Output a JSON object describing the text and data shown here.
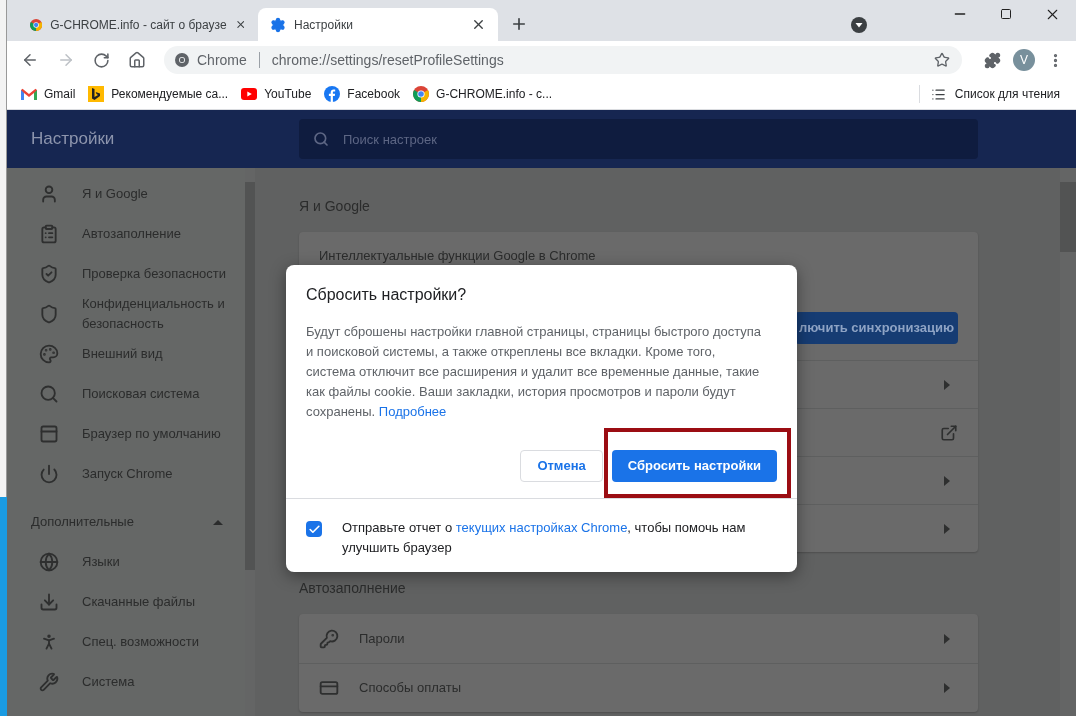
{
  "tabs": [
    {
      "title": "G-CHROME.info - сайт о браузе",
      "kind": "chrome",
      "selected": false
    },
    {
      "title": "Настройки",
      "kind": "gear",
      "selected": true
    }
  ],
  "nav": {
    "back_disabled": false,
    "forward_disabled": true
  },
  "address": {
    "site": "Chrome",
    "url": "chrome://settings/resetProfileSettings"
  },
  "profile": {
    "initial": "V"
  },
  "bookmarks": [
    {
      "label": "Gmail",
      "kind": "gmail"
    },
    {
      "label": "Рекомендуемые са...",
      "kind": "bing"
    },
    {
      "label": "YouTube",
      "kind": "youtube"
    },
    {
      "label": "Facebook",
      "kind": "facebook"
    },
    {
      "label": "G-CHROME.info - с...",
      "kind": "chrome"
    }
  ],
  "reading_list": "Список для чтения",
  "settings": {
    "title": "Настройки",
    "search_placeholder": "Поиск настроек"
  },
  "sidebar": {
    "items": [
      {
        "label": "Я и Google",
        "kind": "person"
      },
      {
        "label": "Автозаполнение",
        "kind": "clipboard"
      },
      {
        "label": "Проверка безопасности",
        "kind": "shield-check"
      },
      {
        "label": "Конфиденциальность и безопасность",
        "kind": "shield"
      },
      {
        "label": "Внешний вид",
        "kind": "palette"
      },
      {
        "label": "Поисковая система",
        "kind": "search"
      },
      {
        "label": "Браузер по умолчанию",
        "kind": "browser"
      },
      {
        "label": "Запуск Chrome",
        "kind": "power"
      }
    ],
    "advanced": {
      "label": "Дополнительные",
      "expanded": true
    },
    "advanced_items": [
      {
        "label": "Языки",
        "kind": "globe"
      },
      {
        "label": "Скачанные файлы",
        "kind": "download"
      },
      {
        "label": "Спец. возможности",
        "kind": "accessibility"
      },
      {
        "label": "Система",
        "kind": "wrench"
      }
    ]
  },
  "sections": [
    {
      "heading": "Я и Google",
      "rows": [
        {
          "kind": "text",
          "label": "Интеллектуальные функции Google в Chrome"
        },
        {
          "kind": "button",
          "label": "лючить синхронизацию"
        },
        {
          "kind": "arrow"
        },
        {
          "kind": "external"
        },
        {
          "kind": "arrow"
        },
        {
          "kind": "arrow"
        }
      ]
    },
    {
      "heading": "Автозаполнение",
      "rows": [
        {
          "kind": "key",
          "label": "Пароли"
        },
        {
          "kind": "card",
          "label": "Способы оплаты"
        }
      ]
    }
  ],
  "dialog": {
    "title": "Сбросить настройки?",
    "body": "Будут сброшены настройки главной страницы, страницы быстрого доступа и поисковой системы, а также откреплены все вкладки. Кроме того, система отключит все расширения и удалит все временные данные, такие как файлы cookie. Ваши закладки, история просмотров и пароли будут сохранены.",
    "body_link": "Подробнее",
    "cancel": "Отмена",
    "confirm": {
      "label": "Сбросить настройки",
      "highlighted": true
    },
    "report": {
      "checked": true,
      "before": "Отправьте отчет о",
      "link": "текущих настройках Chrome",
      "after": ", чтобы помочь нам улучшить браузер"
    }
  }
}
